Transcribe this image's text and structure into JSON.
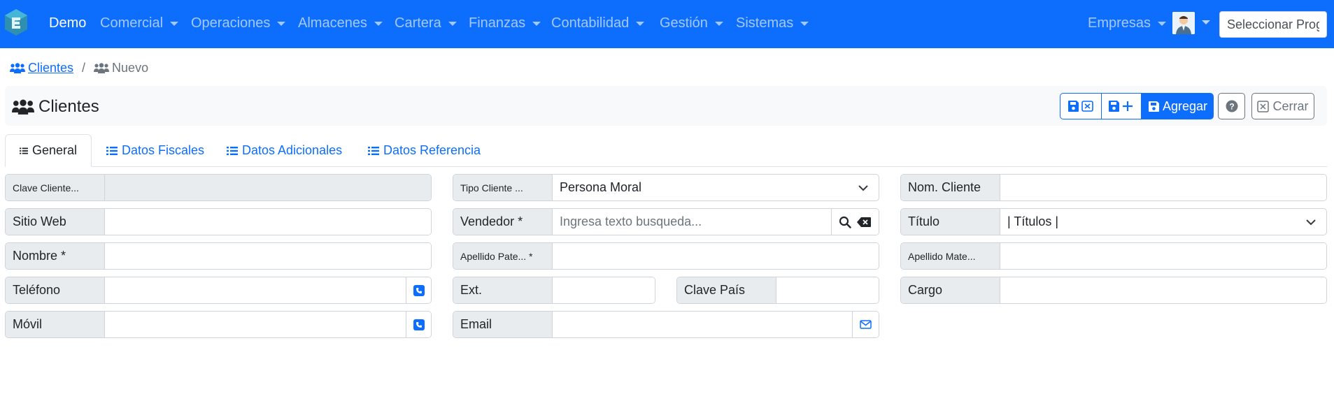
{
  "navbar": {
    "brand": "Demo",
    "menus": [
      {
        "label": "Comercial"
      },
      {
        "label": "Operaciones"
      },
      {
        "label": "Almacenes"
      },
      {
        "label": "Cartera"
      },
      {
        "label": "Finanzas"
      },
      {
        "label": "Contabilidad"
      },
      {
        "label": "Gestión"
      },
      {
        "label": "Sistemas"
      }
    ],
    "empresas_label": "Empresas",
    "program_search_placeholder": "Seleccionar Progr"
  },
  "breadcrumb": {
    "parent": "Clientes",
    "current": "Nuevo"
  },
  "header": {
    "title": "Clientes",
    "add_label": "Agregar",
    "close_label": "Cerrar"
  },
  "tabs": [
    {
      "label": "General",
      "active": true
    },
    {
      "label": "Datos Fiscales"
    },
    {
      "label": "Datos Adicionales"
    },
    {
      "label": "Datos Referencia"
    }
  ],
  "form": {
    "clave_cliente": {
      "label": "Clave Cliente...",
      "value": ""
    },
    "tipo_cliente": {
      "label": "Tipo Cliente ...",
      "value": "Persona Moral"
    },
    "nom_cliente": {
      "label": "Nom. Cliente",
      "value": ""
    },
    "sitio_web": {
      "label": "Sitio Web",
      "value": ""
    },
    "vendedor": {
      "label": "Vendedor *",
      "placeholder": "Ingresa texto busqueda..."
    },
    "titulo": {
      "label": "Título",
      "value": "| Títulos |"
    },
    "nombre": {
      "label": "Nombre *",
      "value": ""
    },
    "apellido_paterno": {
      "label": "Apellido Pate... *",
      "value": ""
    },
    "apellido_materno": {
      "label": "Apellido Mate...",
      "value": ""
    },
    "telefono": {
      "label": "Teléfono",
      "value": ""
    },
    "ext": {
      "label": "Ext.",
      "value": ""
    },
    "clave_pais": {
      "label": "Clave País",
      "value": ""
    },
    "cargo": {
      "label": "Cargo",
      "value": ""
    },
    "movil": {
      "label": "Móvil",
      "value": ""
    },
    "email": {
      "label": "Email",
      "value": ""
    }
  },
  "colors": {
    "primary": "#0d6efd",
    "label_bg": "#e9ecef",
    "header_bg": "#f8f9fa"
  }
}
